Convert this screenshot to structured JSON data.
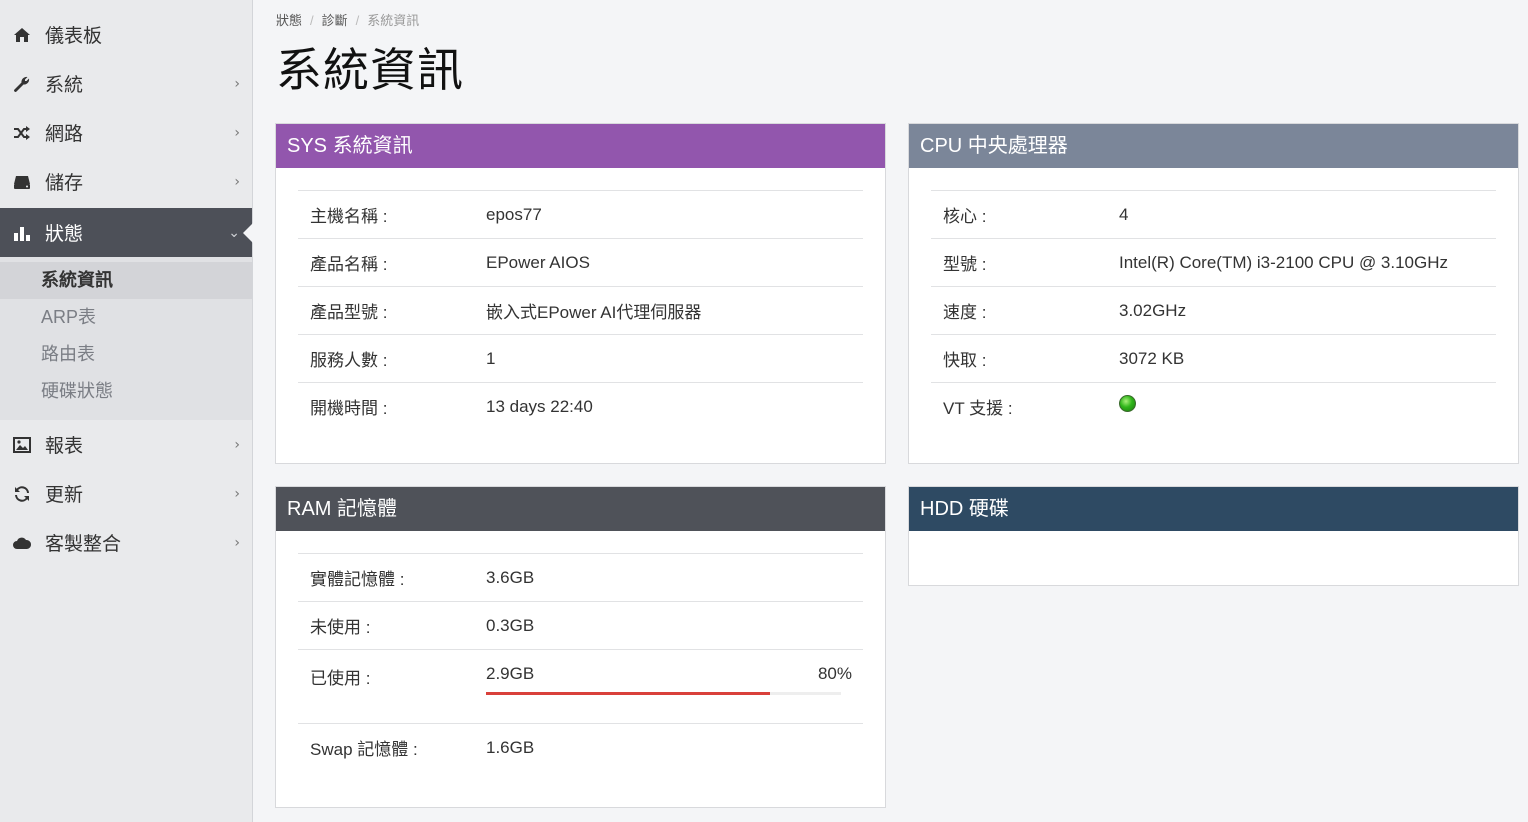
{
  "sidebar": {
    "items": [
      {
        "label": "儀表板",
        "icon": "home-icon"
      },
      {
        "label": "系統",
        "icon": "wrench-icon"
      },
      {
        "label": "網路",
        "icon": "shuffle-icon"
      },
      {
        "label": "儲存",
        "icon": "drive-icon"
      },
      {
        "label": "狀態",
        "icon": "bar-chart-icon"
      },
      {
        "label": "報表",
        "icon": "image-icon"
      },
      {
        "label": "更新",
        "icon": "refresh-icon"
      },
      {
        "label": "客製整合",
        "icon": "cloud-icon"
      }
    ],
    "submenu": [
      "系統資訊",
      "ARP表",
      "路由表",
      "硬碟狀態"
    ]
  },
  "breadcrumb": [
    "狀態",
    "診斷",
    "系統資訊"
  ],
  "page_title": "系統資訊",
  "sys": {
    "title": "SYS 系統資訊",
    "color": "#9256ad",
    "rows": [
      {
        "label": "主機名稱 :",
        "value": "epos77"
      },
      {
        "label": "產品名稱 :",
        "value": "EPower AIOS"
      },
      {
        "label": "產品型號 :",
        "value": "嵌入式EPower AI代理伺服器"
      },
      {
        "label": "服務人數 :",
        "value": "1"
      },
      {
        "label": "開機時間 :",
        "value": "13 days 22:40"
      }
    ]
  },
  "cpu": {
    "title": "CPU 中央處理器",
    "color": "#7b8699",
    "rows": [
      {
        "label": "核心 :",
        "value": "4"
      },
      {
        "label": "型號 :",
        "value": "Intel(R) Core(TM) i3-2100 CPU @ 3.10GHz"
      },
      {
        "label": "速度 :",
        "value": "3.02GHz"
      },
      {
        "label": "快取 :",
        "value": "3072 KB"
      },
      {
        "label": "VT 支援 :",
        "status": "enabled"
      }
    ]
  },
  "ram": {
    "title": "RAM 記憶體",
    "color": "#4f5259",
    "physical_label": "實體記憶體 :",
    "physical_value": "3.6GB",
    "free_label": "未使用 :",
    "free_value": "0.3GB",
    "used_label": "已使用 :",
    "used_value": "2.9GB",
    "used_percent_text": "80%",
    "used_fraction": 0.8,
    "swap_label": "Swap 記憶體 :",
    "swap_value": "1.6GB",
    "bar_color": "#d9403b"
  },
  "hdd": {
    "title": "HDD 硬碟",
    "color": "#2e4a63"
  }
}
